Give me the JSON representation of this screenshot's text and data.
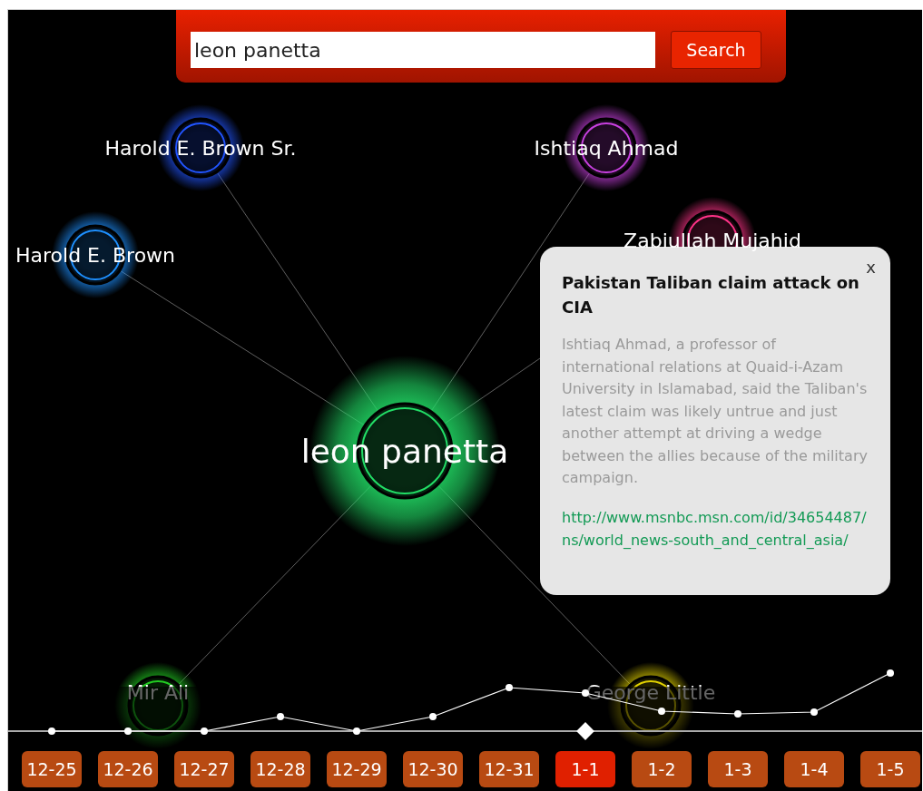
{
  "search": {
    "value": "leon panetta",
    "button": "Search"
  },
  "nodes": [
    {
      "name": "leon panetta",
      "kind": "center",
      "color": "#22dd66"
    },
    {
      "name": "Harold E. Brown Sr.",
      "kind": "person",
      "color": "#2255ff"
    },
    {
      "name": "Harold E. Brown",
      "kind": "person",
      "color": "#1e90ff"
    },
    {
      "name": "Ishtiaq Ahmad",
      "kind": "person",
      "color": "#c840e0"
    },
    {
      "name": "Zabiullah Mujahid",
      "kind": "person",
      "color": "#ff3388"
    },
    {
      "name": "Mir Ali",
      "kind": "person",
      "color": "#22cc22"
    },
    {
      "name": "George Little",
      "kind": "person",
      "color": "#e0d000"
    }
  ],
  "popup": {
    "title": "Pakistan Taliban claim attack on CIA",
    "close": "x",
    "body": "Ishtiaq Ahmad, a professor of international relations at Quaid-i-Azam University in Islamabad, said the Taliban's latest claim was likely untrue and just another attempt at driving a wedge between the allies because of the military campaign.",
    "link": "http://www.msnbc.msn.com/id/34654487/ns/world_news-south_and_central_asia/"
  },
  "dates": [
    {
      "label": "12-25",
      "selected": false
    },
    {
      "label": "12-26",
      "selected": false
    },
    {
      "label": "12-27",
      "selected": false
    },
    {
      "label": "12-28",
      "selected": false
    },
    {
      "label": "12-29",
      "selected": false
    },
    {
      "label": "12-30",
      "selected": false
    },
    {
      "label": "12-31",
      "selected": false
    },
    {
      "label": "1-1",
      "selected": true
    },
    {
      "label": "1-2",
      "selected": false
    },
    {
      "label": "1-3",
      "selected": false
    },
    {
      "label": "1-4",
      "selected": false
    },
    {
      "label": "1-5",
      "selected": false
    }
  ]
}
